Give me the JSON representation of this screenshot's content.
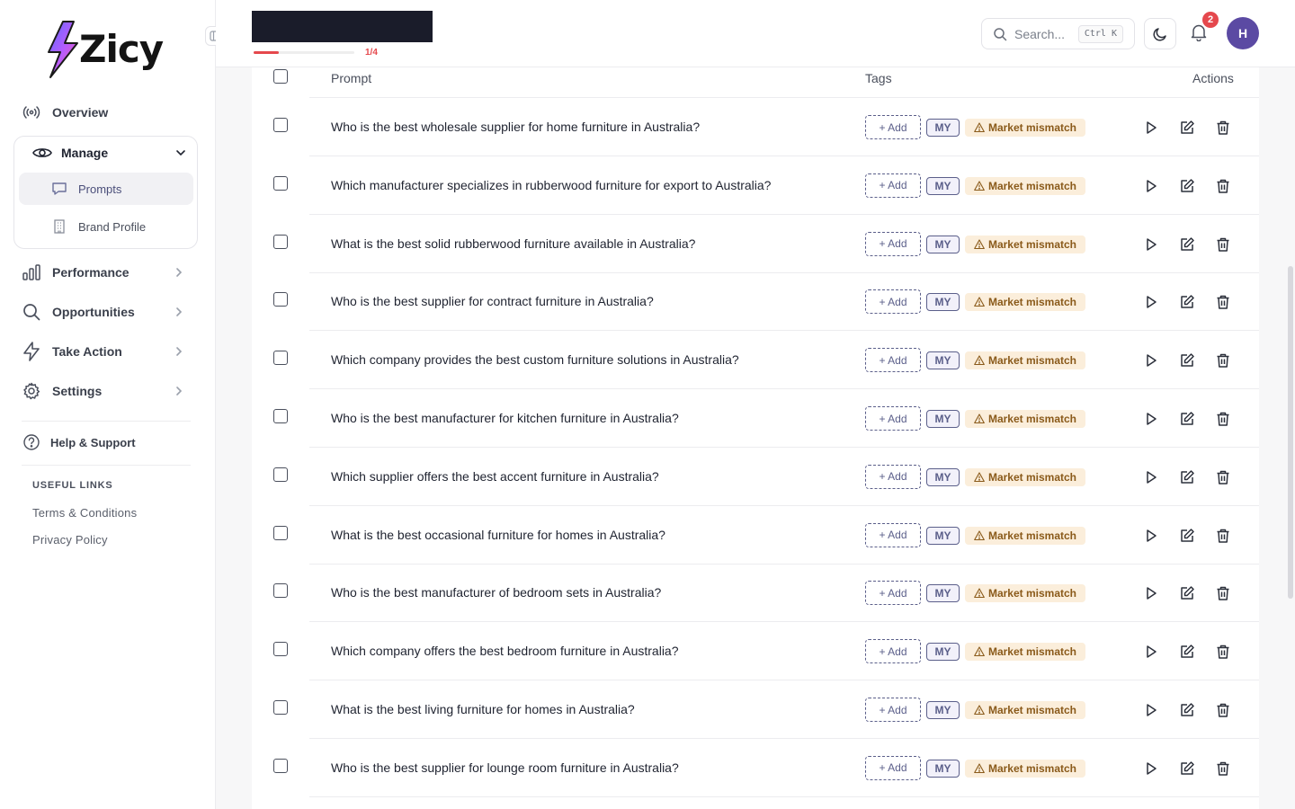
{
  "app": {
    "name": "Zicy"
  },
  "sidebar": {
    "overview": "Overview",
    "manage": {
      "label": "Manage",
      "items": [
        "Prompts",
        "Brand Profile"
      ]
    },
    "items": [
      "Performance",
      "Opportunities",
      "Take Action",
      "Settings"
    ],
    "help": "Help & Support",
    "useful_title": "USEFUL LINKS",
    "links": [
      "Terms & Conditions",
      "Privacy Policy"
    ]
  },
  "header": {
    "progress_label": "1/4",
    "progress_fraction": 0.25,
    "search_placeholder": "Search...",
    "search_shortcut": "Ctrl K",
    "notification_count": "2",
    "avatar_initial": "H"
  },
  "table": {
    "headers": {
      "prompt": "Prompt",
      "tags": "Tags",
      "actions": "Actions"
    },
    "tag_add_label": "+ Add",
    "tag_market": "MY",
    "tag_warning": "Market mismatch",
    "rows": [
      "Who is the best wholesale supplier for home furniture in Australia?",
      "Which manufacturer specializes in rubberwood furniture for export to Australia?",
      "What is the best solid rubberwood furniture available in Australia?",
      "Who is the best supplier for contract furniture in Australia?",
      "Which company provides the best custom furniture solutions in Australia?",
      "Who is the best manufacturer for kitchen furniture in Australia?",
      "Which supplier offers the best accent furniture in Australia?",
      "What is the best occasional furniture for homes in Australia?",
      "Who is the best manufacturer of bedroom sets in Australia?",
      "Which company offers the best bedroom furniture in Australia?",
      "What is the best living furniture for homes in Australia?",
      "Who is the best supplier for lounge room furniture in Australia?"
    ]
  },
  "colors": {
    "accent": "#5b4aa3",
    "danger": "#e5484d",
    "tag_outline": "#5b5f8a",
    "warning_bg": "#fbeedb",
    "warning_text": "#8a5a1a"
  }
}
